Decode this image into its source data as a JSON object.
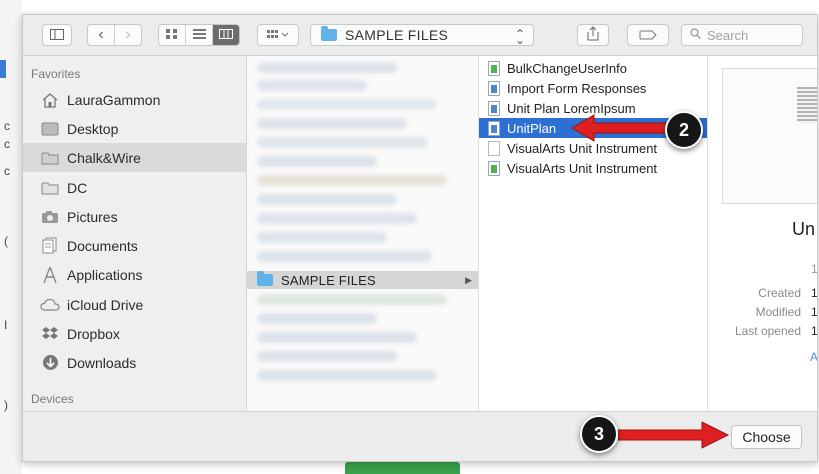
{
  "toolbar": {
    "path_label": "SAMPLE FILES",
    "search_placeholder": "Search",
    "icons": [
      "sidebar-toggle-icon",
      "back-icon",
      "forward-icon",
      "icon-view-icon",
      "list-view-icon",
      "column-view-icon",
      "arrange-icon",
      "share-icon",
      "tag-icon",
      "search-icon"
    ]
  },
  "sidebar": {
    "favorites_heading": "Favorites",
    "devices_heading": "Devices",
    "items": [
      {
        "label": "LauraGammon",
        "icon": "home-icon"
      },
      {
        "label": "Desktop",
        "icon": "desktop-folder-icon"
      },
      {
        "label": "Chalk&Wire",
        "icon": "folder-icon",
        "selected": true
      },
      {
        "label": "DC",
        "icon": "folder-icon"
      },
      {
        "label": "Pictures",
        "icon": "camera-icon"
      },
      {
        "label": "Documents",
        "icon": "documents-icon"
      },
      {
        "label": "Applications",
        "icon": "applications-icon"
      },
      {
        "label": "iCloud Drive",
        "icon": "cloud-icon"
      },
      {
        "label": "Dropbox",
        "icon": "dropbox-icon"
      },
      {
        "label": "Downloads",
        "icon": "download-icon"
      }
    ]
  },
  "column1": {
    "selected_folder": "SAMPLE FILES"
  },
  "column2": {
    "files": [
      {
        "label": "BulkChangeUserInfo",
        "icon": "spreadsheet-file-icon"
      },
      {
        "label": "Import Form Responses",
        "icon": "doc-file-icon"
      },
      {
        "label": "Unit Plan LoremIpsum",
        "icon": "doc-file-icon"
      },
      {
        "label": "UnitPlan",
        "icon": "doc-file-icon",
        "selected": true
      },
      {
        "label": "VisualArts Unit Instrument",
        "icon": "blank-file-icon"
      },
      {
        "label": "VisualArts Unit Instrument",
        "icon": "spreadsheet-file-icon"
      }
    ]
  },
  "preview": {
    "title_fragment": "Un",
    "size_fragment": "1",
    "meta": [
      {
        "key": "Created",
        "value": "1"
      },
      {
        "key": "Modified",
        "value": "1"
      },
      {
        "key": "Last opened",
        "value": "1"
      }
    ],
    "link_fragment": "A"
  },
  "bottom": {
    "choose_label": "Choose"
  },
  "annotations": {
    "step_2": "2",
    "step_3": "3",
    "arrow_color": "#e02020"
  },
  "background": {
    "left_marks": [
      "c",
      "c",
      "c",
      "(",
      "I",
      ")"
    ]
  }
}
